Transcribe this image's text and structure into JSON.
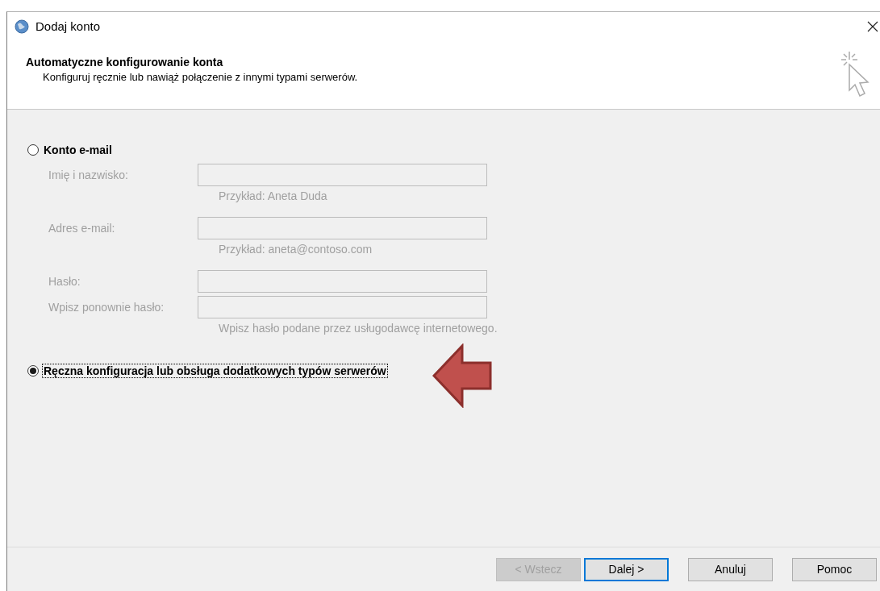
{
  "window": {
    "title": "Dodaj konto"
  },
  "header": {
    "title": "Automatyczne konfigurowanie konta",
    "subtitle": "Konfiguruj ręcznie lub nawiąż połączenie z innymi typami serwerów."
  },
  "options": [
    {
      "label": "Konto e-mail",
      "selected": false,
      "focused": false
    },
    {
      "label": "Ręczna konfiguracja lub obsługa dodatkowych typów serwerów",
      "selected": true,
      "focused": true
    }
  ],
  "fields": [
    {
      "label": "Imię i nazwisko:",
      "hint": "Przykład: Aneta Duda",
      "disabled": true
    },
    {
      "label": "Adres e-mail:",
      "hint": "Przykład: aneta@contoso.com",
      "disabled": true
    },
    {
      "label": "Hasło:",
      "disabled": true
    },
    {
      "label": "Wpisz ponownie hasło:",
      "hint": "Wpisz hasło podane przez usługodawcę internetowego.",
      "disabled": true
    }
  ],
  "buttons": [
    {
      "label": "< Wstecz",
      "disabled": true,
      "default": false
    },
    {
      "label": "Dalej >",
      "disabled": false,
      "default": true
    },
    {
      "label": "Anuluj",
      "disabled": false,
      "default": false
    },
    {
      "label": "Pomoc",
      "disabled": false,
      "default": false
    }
  ]
}
